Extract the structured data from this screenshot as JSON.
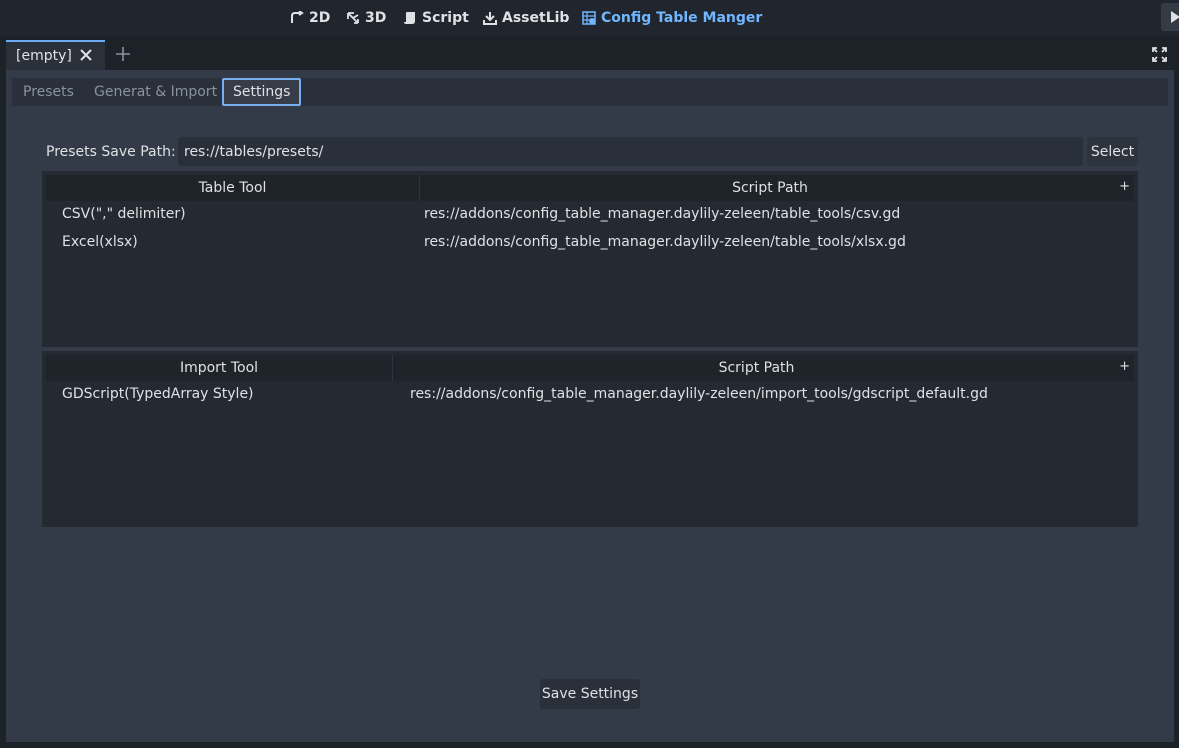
{
  "toolbar": {
    "workspaces": [
      {
        "label": "2D",
        "icon": "2d-icon"
      },
      {
        "label": "3D",
        "icon": "3d-icon"
      },
      {
        "label": "Script",
        "icon": "script-icon"
      },
      {
        "label": "AssetLib",
        "icon": "download-icon"
      },
      {
        "label": "Config Table Manger",
        "icon": "table-icon"
      }
    ],
    "active_color": "#70b7ff"
  },
  "scene_tabs": {
    "tab_label": "[empty]"
  },
  "subtabs": {
    "presets": "Presets",
    "generate": "Generat & Import",
    "settings": "Settings"
  },
  "settings": {
    "presets_save_path_label": "Presets Save Path:",
    "presets_save_path_value": "res://tables/presets/",
    "select_label": "Select",
    "table_tools": {
      "header_tool": "Table Tool",
      "header_path": "Script Path",
      "add_label": "+",
      "rows": [
        {
          "tool": "CSV(\",\" delimiter)",
          "path": "res://addons/config_table_manager.daylily-zeleen/table_tools/csv.gd"
        },
        {
          "tool": "Excel(xlsx)",
          "path": "res://addons/config_table_manager.daylily-zeleen/table_tools/xlsx.gd"
        }
      ]
    },
    "import_tools": {
      "header_tool": "Import Tool",
      "header_path": "Script Path",
      "add_label": "+",
      "rows": [
        {
          "tool": "GDScript(TypedArray Style)",
          "path": "res://addons/config_table_manager.daylily-zeleen/import_tools/gdscript_default.gd"
        }
      ]
    },
    "save_label": "Save Settings"
  }
}
